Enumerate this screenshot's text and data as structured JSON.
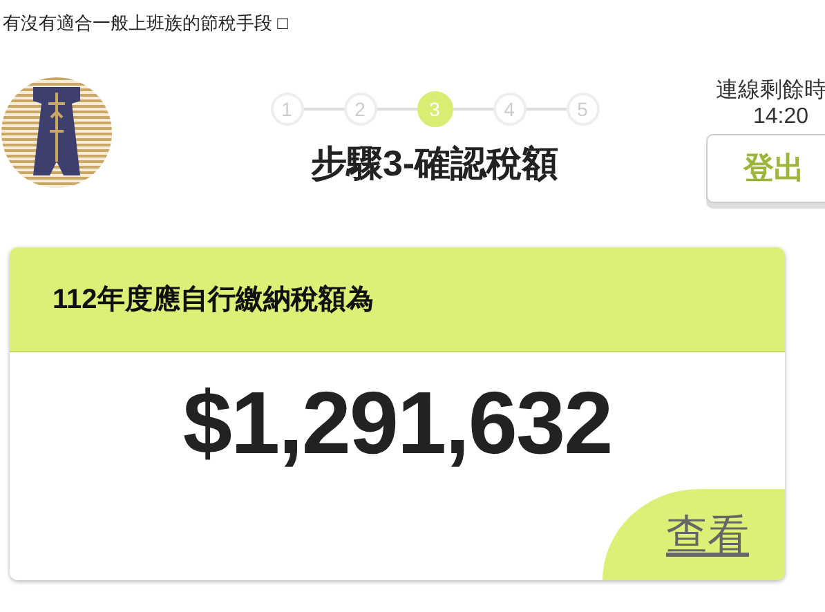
{
  "top_text": "有沒有適合一般上班族的節稅手段 □",
  "steps": [
    {
      "label": "1",
      "selected": false
    },
    {
      "label": "2",
      "selected": false
    },
    {
      "label": "3",
      "selected": true
    },
    {
      "label": "4",
      "selected": false
    },
    {
      "label": "5",
      "selected": false
    }
  ],
  "page_title": "步驟3-確認稅額",
  "session": {
    "label": "連線剩餘時",
    "time": "14:20"
  },
  "logout_button": "登出",
  "card": {
    "heading": "112年度應自行繳納稅額為",
    "amount": "$1,291,632",
    "view_link": "查看"
  }
}
